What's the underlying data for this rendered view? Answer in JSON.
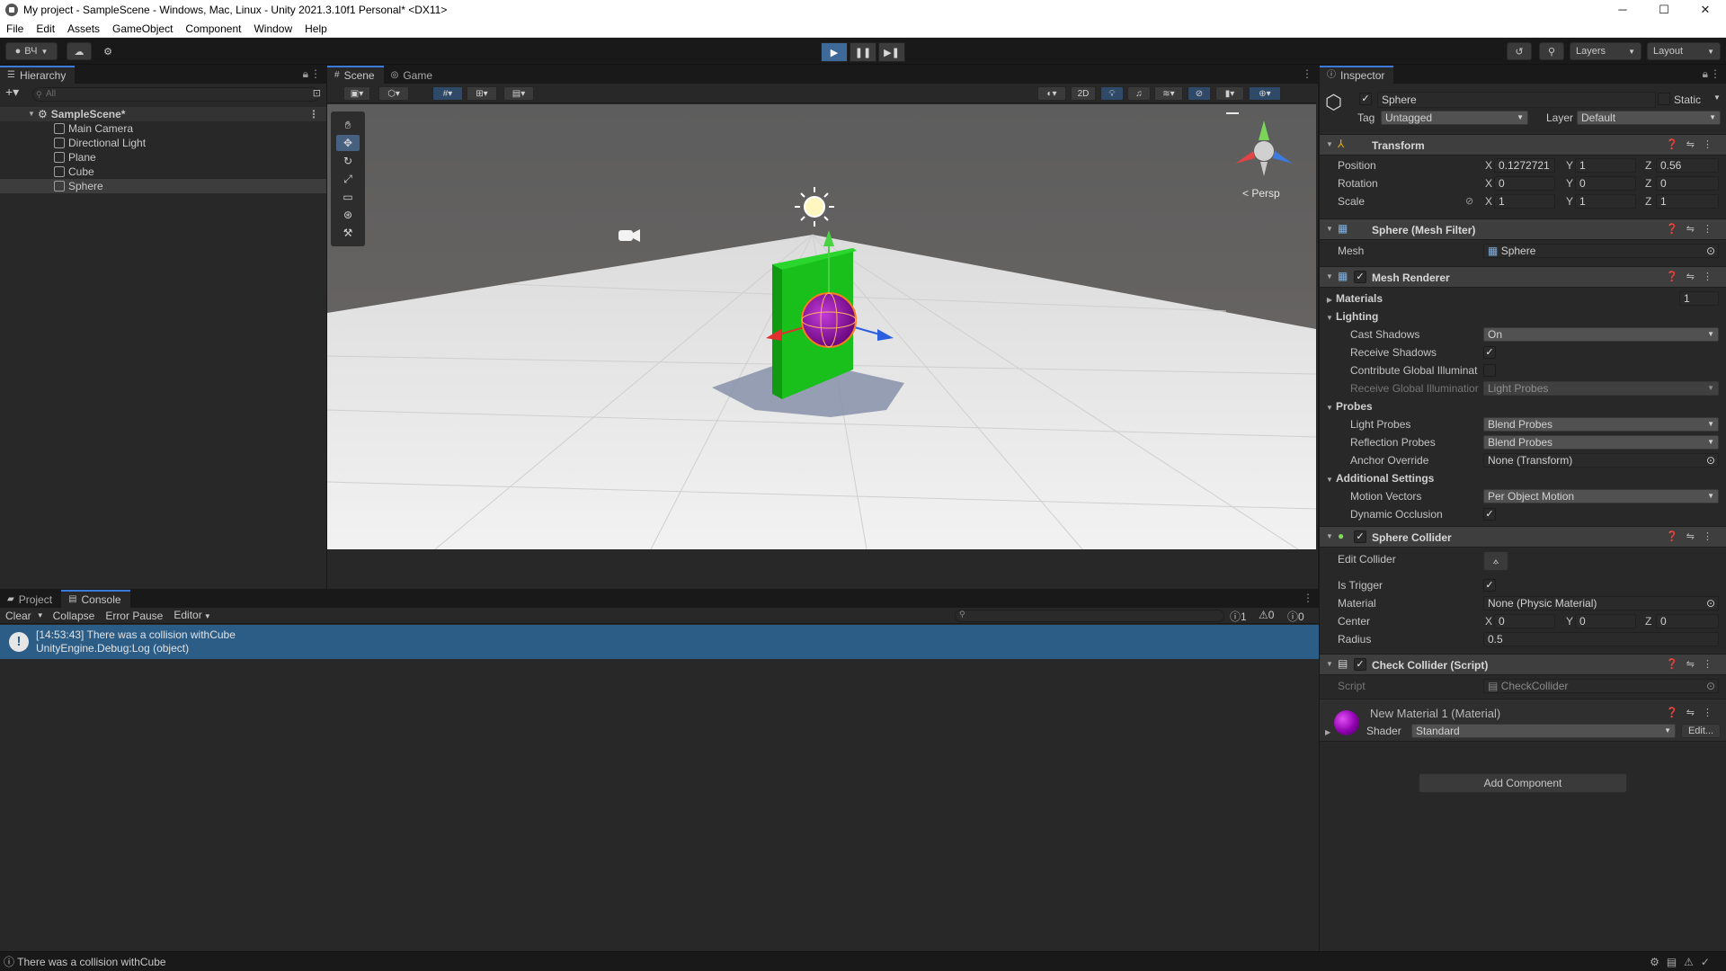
{
  "window": {
    "title": "My project - SampleScene - Windows, Mac, Linux - Unity 2021.3.10f1 Personal* <DX11>",
    "minimize": "─",
    "maximize": "☐",
    "close": "✕"
  },
  "menu": [
    "File",
    "Edit",
    "Assets",
    "GameObject",
    "Component",
    "Window",
    "Help"
  ],
  "toolbar": {
    "account": "ВЧ",
    "layers": "Layers",
    "layout": "Layout"
  },
  "hierarchy": {
    "tab": "Hierarchy",
    "search_placeholder": "All",
    "scene": "SampleScene*",
    "items": [
      "Main Camera",
      "Directional Light",
      "Plane",
      "Cube",
      "Sphere"
    ]
  },
  "scene_view": {
    "tabs": [
      "Scene",
      "Game"
    ],
    "mode_2d": "2D",
    "persp_label": "Persp"
  },
  "console": {
    "tabs": [
      "Project",
      "Console"
    ],
    "buttons": [
      "Clear",
      "Collapse",
      "Error Pause",
      "Editor"
    ],
    "counts": {
      "log": "1",
      "warn": "0",
      "error": "0"
    },
    "entries": [
      {
        "line1": "[14:53:43] There was a collision withCube",
        "line2": "UnityEngine.Debug:Log (object)"
      }
    ]
  },
  "status_bar": {
    "message": "There was a collision withCube"
  },
  "inspector": {
    "tab": "Inspector",
    "object_name": "Sphere",
    "static_label": "Static",
    "tag_label": "Tag",
    "tag_value": "Untagged",
    "layer_label": "Layer",
    "layer_value": "Default",
    "transform": {
      "title": "Transform",
      "position_label": "Position",
      "rotation_label": "Rotation",
      "scale_label": "Scale",
      "position": {
        "x": "0.1272721",
        "y": "1",
        "z": "0.56"
      },
      "rotation": {
        "x": "0",
        "y": "0",
        "z": "0"
      },
      "scale": {
        "x": "1",
        "y": "1",
        "z": "1"
      }
    },
    "mesh_filter": {
      "title": "Sphere (Mesh Filter)",
      "mesh_label": "Mesh",
      "mesh_value": "Sphere"
    },
    "mesh_renderer": {
      "title": "Mesh Renderer",
      "materials_label": "Materials",
      "materials_count": "1",
      "lighting_label": "Lighting",
      "cast_shadows_label": "Cast Shadows",
      "cast_shadows_value": "On",
      "receive_shadows_label": "Receive Shadows",
      "contribute_gi_label": "Contribute Global Illuminat",
      "receive_gi_label": "Receive Global Illuminatior",
      "receive_gi_value": "Light Probes",
      "probes_label": "Probes",
      "light_probes_label": "Light Probes",
      "light_probes_value": "Blend Probes",
      "reflection_probes_label": "Reflection Probes",
      "reflection_probes_value": "Blend Probes",
      "anchor_override_label": "Anchor Override",
      "anchor_override_value": "None (Transform)",
      "additional_label": "Additional Settings",
      "motion_vectors_label": "Motion Vectors",
      "motion_vectors_value": "Per Object Motion",
      "dynamic_occlusion_label": "Dynamic Occlusion"
    },
    "sphere_collider": {
      "title": "Sphere Collider",
      "edit_collider_label": "Edit Collider",
      "is_trigger_label": "Is Trigger",
      "material_label": "Material",
      "material_value": "None (Physic Material)",
      "center_label": "Center",
      "center": {
        "x": "0",
        "y": "0",
        "z": "0"
      },
      "radius_label": "Radius",
      "radius_value": "0.5"
    },
    "check_collider": {
      "title": "Check Collider (Script)",
      "script_label": "Script",
      "script_value": "CheckCollider"
    },
    "material": {
      "title": "New Material 1 (Material)",
      "shader_label": "Shader",
      "shader_value": "Standard",
      "edit_label": "Edit..."
    },
    "add_component": "Add Component",
    "axis": {
      "x": "X",
      "y": "Y",
      "z": "Z"
    },
    "check": "✓"
  },
  "colors": {
    "accent": "#3a7ad9",
    "selection": "#2c5d87",
    "play_active": "#3d6a99",
    "material_purple": "#9a00b8"
  }
}
